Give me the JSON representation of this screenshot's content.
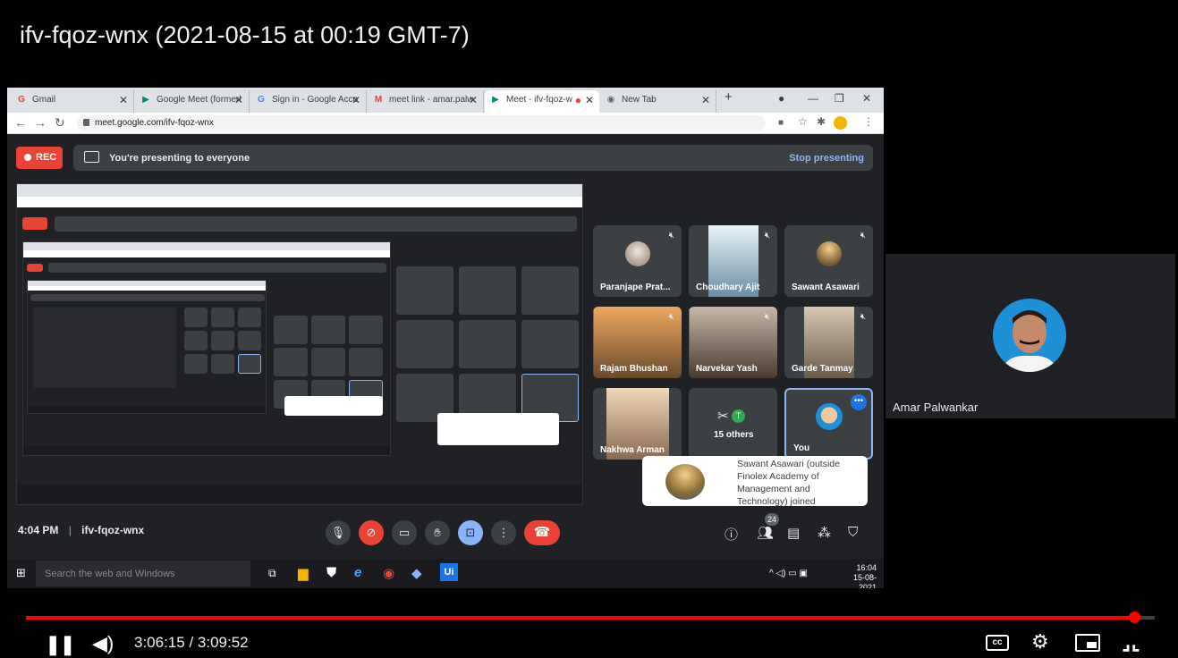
{
  "video": {
    "title": "ifv-fqoz-wnx (2021-08-15 at 00:19 GMT-7)",
    "current_time": "3:06:15",
    "duration": "3:09:52",
    "time_display": "3:06:15 / 3:09:52",
    "progress_fraction": 0.982
  },
  "browser": {
    "tabs": [
      {
        "label": "Gmail",
        "icon": "gmail-icon",
        "active": false
      },
      {
        "label": "Google Meet (formerl",
        "icon": "meet-icon",
        "active": false
      },
      {
        "label": "Sign in - Google Acco",
        "icon": "google-icon",
        "active": false
      },
      {
        "label": "meet link - amar.palw",
        "icon": "gmail-icon",
        "active": false
      },
      {
        "label": "Meet - ifv-fqoz-w",
        "icon": "meet-icon",
        "active": true
      },
      {
        "label": "New Tab",
        "icon": "chrome-icon",
        "active": false
      }
    ],
    "url": "meet.google.com/ifv-fqoz-wnx"
  },
  "meet": {
    "rec_label": "REC",
    "presenting_text": "You're presenting to everyone",
    "stop_label": "Stop presenting",
    "clock": "4:04 PM",
    "meeting_code": "ifv-fqoz-wnx",
    "participant_count": "24",
    "participants": [
      {
        "name": "Paranjape Prat...",
        "muted": true
      },
      {
        "name": "Choudhary Ajit",
        "muted": true
      },
      {
        "name": "Sawant Asawari",
        "muted": true
      },
      {
        "name": "Rajam Bhushan",
        "muted": true
      },
      {
        "name": "Narvekar Yash",
        "muted": true
      },
      {
        "name": "Garde Tanmay",
        "muted": true
      },
      {
        "name": "Nakhwa Arman",
        "muted": false
      },
      {
        "name": "15 others",
        "muted": false
      },
      {
        "name": "You",
        "muted": false
      }
    ],
    "toast_text": "Sawant Asawari (outside Finolex Academy of Management and Technology) joined"
  },
  "taskbar": {
    "search_placeholder": "Search the web and Windows",
    "time": "16:04",
    "date": "15-08-2021"
  },
  "self_view": {
    "name": "Amar Palwankar"
  },
  "colors": {
    "meet_bg": "#202124",
    "tile_bg": "#3c4043",
    "rec_red": "#ea4335",
    "accent_blue": "#8ab4f8",
    "progress_red": "#ff0000"
  }
}
